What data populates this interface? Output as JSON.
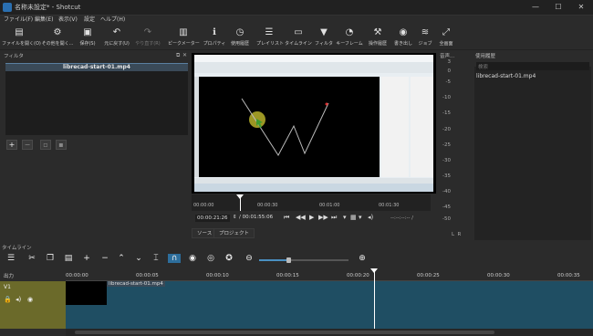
{
  "window": {
    "title": "名称未設定* - Shotcut",
    "minimize": "—",
    "maximize": "☐",
    "close": "✕"
  },
  "menu": [
    "ファイル(F)",
    "編集(E)",
    "表示(V)",
    "設定",
    "ヘルプ(H)"
  ],
  "toolbar": [
    {
      "label": "ファイルを開く(O)",
      "icon": "open-file-icon",
      "glyph": "▤"
    },
    {
      "label": "その他を開く...",
      "icon": "open-other-icon",
      "glyph": "⚙"
    },
    {
      "label": "保存(S)",
      "icon": "save-icon",
      "glyph": "▣"
    },
    {
      "label": "元に戻す(U)",
      "icon": "undo-icon",
      "glyph": "↶"
    },
    {
      "label": "やり直す(R)",
      "icon": "redo-icon",
      "glyph": "↷"
    },
    {
      "label": "ピークメーター",
      "icon": "peak-meter-icon",
      "glyph": "▥"
    },
    {
      "label": "プロパティ",
      "icon": "properties-icon",
      "glyph": "ℹ"
    },
    {
      "label": "使用履歴",
      "icon": "history-icon",
      "glyph": "◷"
    },
    {
      "label": "プレイリスト",
      "icon": "playlist-icon",
      "glyph": "☰"
    },
    {
      "label": "タイムライン",
      "icon": "timeline-icon",
      "glyph": "▭"
    },
    {
      "label": "フィルタ",
      "icon": "filter-icon",
      "glyph": "▼"
    },
    {
      "label": "キーフレーム",
      "icon": "keyframes-icon",
      "glyph": "◔"
    },
    {
      "label": "操作履歴",
      "icon": "jobs-history-icon",
      "glyph": "⚒"
    },
    {
      "label": "書き出し",
      "icon": "export-icon",
      "glyph": "◉"
    },
    {
      "label": "ジョブ",
      "icon": "jobs-icon",
      "glyph": "≋"
    },
    {
      "label": "全画面",
      "icon": "fullscreen-icon",
      "glyph": "⤢"
    }
  ],
  "filters": {
    "title": "フィルタ",
    "clip_name": "librecad-start-01.mp4"
  },
  "player": {
    "ruler_ticks": [
      "00:00:00",
      "00:00:30",
      "00:01:00",
      "00:01:30"
    ],
    "current_time": "00:00:21:26",
    "total_time": "/ 00:01:55:06",
    "in_out": "--:--:--:-- /",
    "tabs": [
      "ソース",
      "プロジェクト"
    ]
  },
  "meter": {
    "title": "音声...",
    "scale": [
      "3",
      "0",
      "-5",
      "-10",
      "-15",
      "-20",
      "-25",
      "-30",
      "-35",
      "-40",
      "-45",
      "-50"
    ],
    "lr": "L  R"
  },
  "history": {
    "title": "使用履歴",
    "search": "検索",
    "items": [
      "librecad-start-01.mp4"
    ]
  },
  "timeline": {
    "title": "タイムライン",
    "output_label": "出力",
    "track_label": "V1",
    "clip_label": "librecad-start-01.mp4",
    "ruler": [
      "00:00:00",
      "00:00:05",
      "00:00:10",
      "00:00:15",
      "00:00:20",
      "00:00:25",
      "00:00:30",
      "00:00:35"
    ]
  }
}
